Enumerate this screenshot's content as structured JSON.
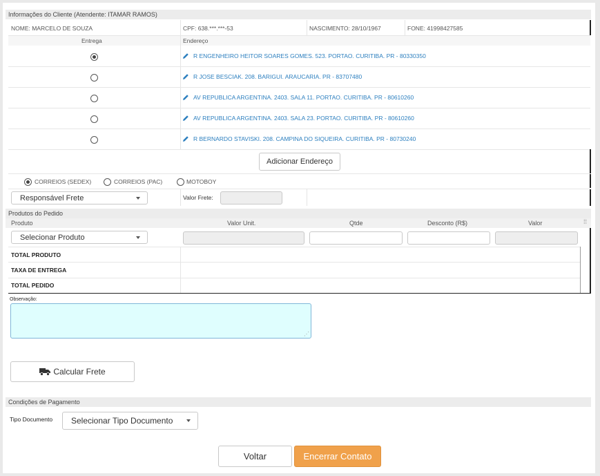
{
  "client": {
    "header": "Informações do Cliente (Atendente: ITAMAR RAMOS)",
    "name": "NOME: MARCELO DE SOUZA",
    "cpf": "CPF: 638.***.***-53",
    "birth": "NASCIMENTO: 28/10/1967",
    "phone": "FONE: 41998427585"
  },
  "addresses": {
    "col_delivery": "Entrega",
    "col_address": "Endereço",
    "items": [
      {
        "text": "R ENGENHEIRO HEITOR SOARES GOMES. 523. PORTAO. CURITIBA. PR - 80330350",
        "selected": true
      },
      {
        "text": "R JOSE BESCIAK. 208. BARIGUI. ARAUCARIA. PR - 83707480",
        "selected": false
      },
      {
        "text": "AV REPUBLICA ARGENTINA. 2403. SALA 11. PORTAO. CURITIBA. PR - 80610260",
        "selected": false
      },
      {
        "text": "AV REPUBLICA ARGENTINA. 2403. SALA 23. PORTAO. CURITIBA. PR - 80610260",
        "selected": false
      },
      {
        "text": "R BERNARDO STAVISKI. 208. CAMPINA DO SIQUEIRA. CURITIBA. PR - 80730240",
        "selected": false
      }
    ],
    "add_button": "Adicionar Endereço"
  },
  "shipping": {
    "options": [
      {
        "label": "CORREIOS (SEDEX)",
        "selected": true
      },
      {
        "label": "CORREIOS (PAC)",
        "selected": false
      },
      {
        "label": "MOTOBOY",
        "selected": false
      }
    ],
    "responsible_select": "Responsável Frete",
    "freight_label": "Valor Frete:",
    "freight_value": ""
  },
  "products": {
    "header": "Produtos do Pedido",
    "columns": {
      "product": "Produto",
      "unit_value": "Valor Unit.",
      "qty": "Qtde",
      "discount": "Desconto (R$)",
      "value": "Valor"
    },
    "select_label": "Selecionar Produto",
    "totals": [
      "TOTAL PRODUTO",
      "TAXA DE ENTREGA",
      "TOTAL PEDIDO"
    ]
  },
  "notes": {
    "label": "Observação:",
    "value": ""
  },
  "calc_button": "Calcular Frete",
  "payment": {
    "header": "Condições de Pagamento",
    "doc_label": "Tipo Documento",
    "doc_select": "Selecionar Tipo Documento"
  },
  "actions": {
    "back": "Voltar",
    "close": "Encerrar Contato"
  },
  "colors": {
    "accent": "#f0a14b",
    "link": "#2c7fbf",
    "textarea_bg": "#dffefe"
  }
}
